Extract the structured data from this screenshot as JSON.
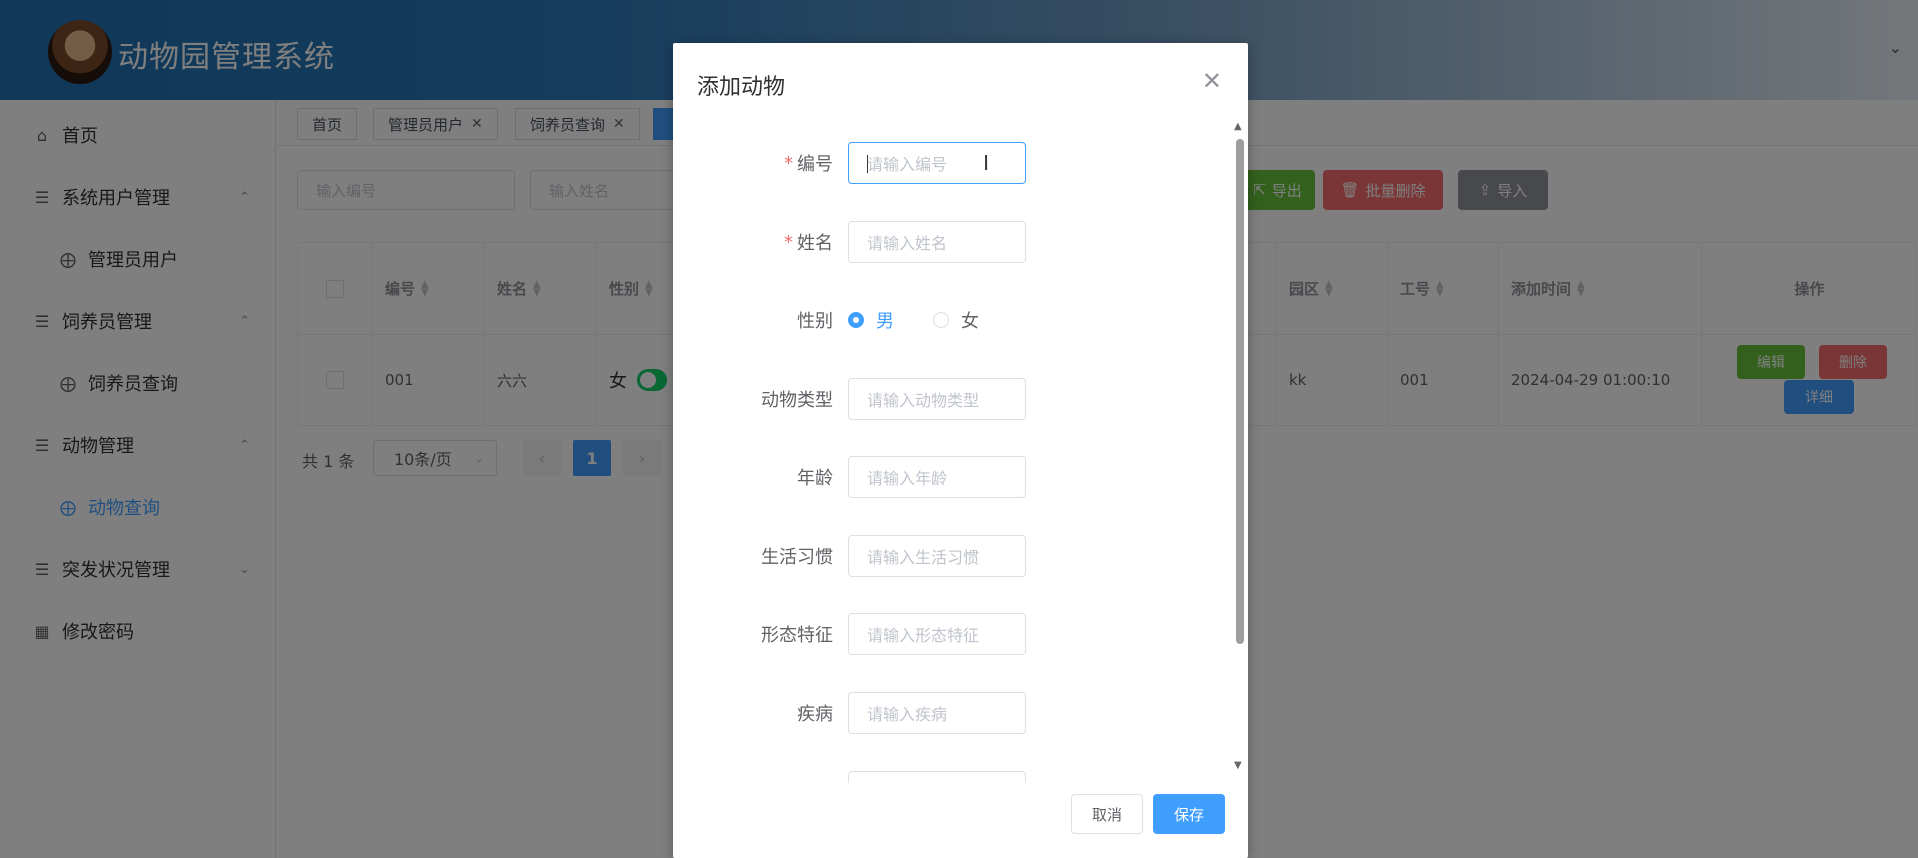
{
  "app": {
    "title": "动物园管理系统"
  },
  "sidebar": {
    "items": [
      {
        "label": "首页",
        "icon": "home-icon"
      },
      {
        "label": "系统用户管理",
        "icon": "stack-icon"
      },
      {
        "label": "管理员用户",
        "icon": "sub-icon"
      },
      {
        "label": "饲养员管理",
        "icon": "stack-icon"
      },
      {
        "label": "饲养员查询",
        "icon": "sub-icon"
      },
      {
        "label": "动物管理",
        "icon": "stack-icon"
      },
      {
        "label": "动物查询",
        "icon": "sub-icon"
      },
      {
        "label": "突发状况管理",
        "icon": "stack-icon"
      },
      {
        "label": "修改密码",
        "icon": "grid-icon"
      }
    ]
  },
  "tabs": [
    {
      "label": "首页"
    },
    {
      "label": "管理员用户"
    },
    {
      "label": "饲养员查询"
    }
  ],
  "search": {
    "code_placeholder": "输入编号",
    "name_placeholder": "输入姓名"
  },
  "toolbar": {
    "export_label": "导出",
    "batch_delete_label": "批量删除",
    "import_label": "导入"
  },
  "table": {
    "headers": {
      "code": "编号",
      "name": "姓名",
      "gender": "性别",
      "zone": "园区",
      "job_no": "工号",
      "added_time": "添加时间",
      "actions": "操作"
    },
    "rows": [
      {
        "code": "001",
        "name": "六六",
        "gender": "女",
        "zone": "kk",
        "job_no": "001",
        "added_time": "2024-04-29 01:00:10"
      }
    ],
    "edit_label": "编辑",
    "delete_label": "删除",
    "detail_label": "详细"
  },
  "pagination": {
    "total": "共 1 条",
    "page_size": "10条/页",
    "current": "1"
  },
  "dialog": {
    "title": "添加动物",
    "fields": [
      {
        "label": "编号",
        "placeholder": "请输入编号",
        "required": true
      },
      {
        "label": "姓名",
        "placeholder": "请输入姓名",
        "required": true
      },
      {
        "label": "动物类型",
        "placeholder": "请输入动物类型"
      },
      {
        "label": "年龄",
        "placeholder": "请输入年龄"
      },
      {
        "label": "生活习惯",
        "placeholder": "请输入生活习惯"
      },
      {
        "label": "形态特征",
        "placeholder": "请输入形态特征"
      },
      {
        "label": "疾病",
        "placeholder": "请输入疾病"
      }
    ],
    "gender": {
      "label": "性别",
      "options": [
        "男",
        "女"
      ],
      "selected": "男"
    },
    "cancel_label": "取消",
    "save_label": "保存"
  },
  "colors": {
    "primary": "#409eff",
    "success": "#13ce66",
    "danger": "#f56c6c",
    "required": "#f56c6c"
  }
}
